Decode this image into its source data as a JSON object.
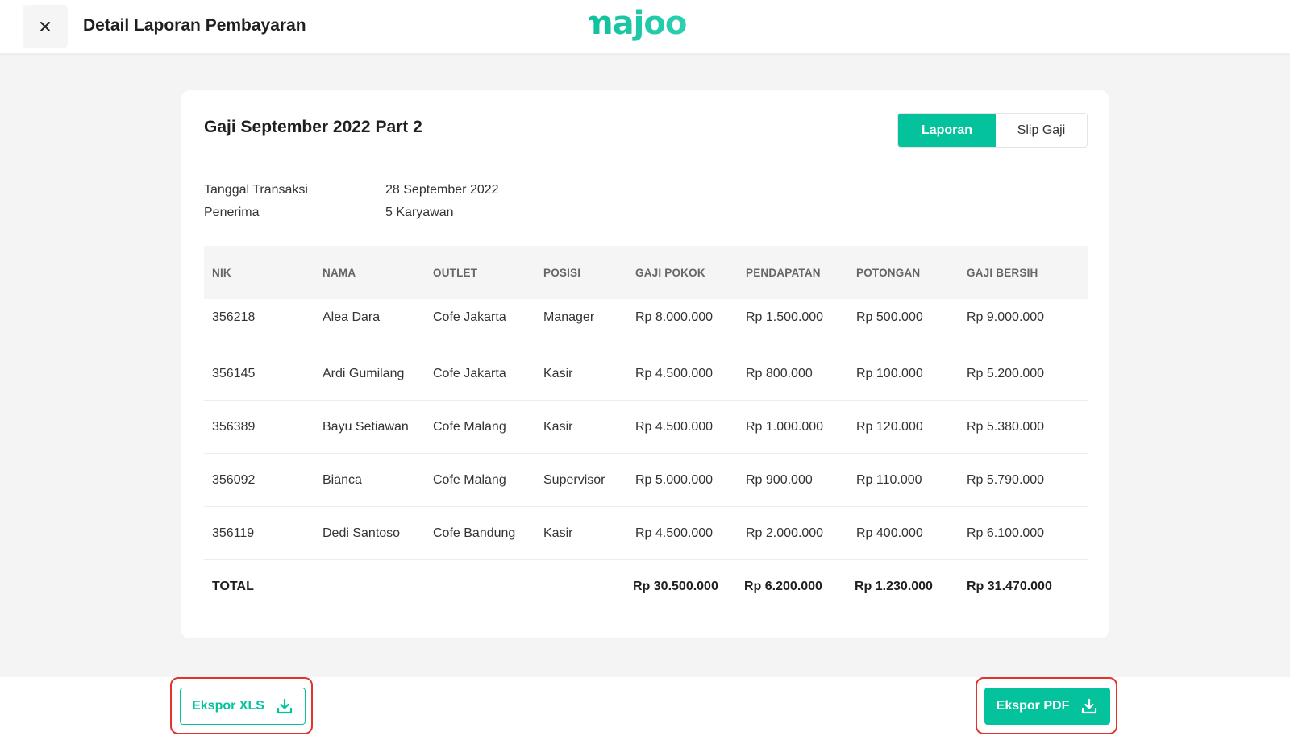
{
  "header": {
    "title": "Detail Laporan Pembayaran",
    "logo_text": "majoo",
    "brand_color": "#04c29c"
  },
  "report": {
    "title": "Gaji September 2022 Part 2",
    "tabs": [
      {
        "label": "Laporan",
        "active": true
      },
      {
        "label": "Slip Gaji",
        "active": false
      }
    ],
    "meta": [
      {
        "label": "Tanggal Transaksi",
        "value": "28 September 2022"
      },
      {
        "label": "Penerima",
        "value": "5 Karyawan"
      }
    ]
  },
  "table": {
    "columns": [
      "NIK",
      "NAMA",
      "OUTLET",
      "POSISI",
      "GAJI POKOK",
      "PENDAPATAN",
      "POTONGAN",
      "GAJI BERSIH"
    ],
    "rows": [
      [
        "356218",
        "Alea Dara",
        "Cofe Jakarta",
        "Manager",
        "Rp 8.000.000",
        "Rp 1.500.000",
        "Rp 500.000",
        "Rp 9.000.000"
      ],
      [
        "356145",
        "Ardi Gumilang",
        "Cofe Jakarta",
        "Kasir",
        "Rp 4.500.000",
        "Rp 800.000",
        "Rp 100.000",
        "Rp 5.200.000"
      ],
      [
        "356389",
        "Bayu Setiawan",
        "Cofe Malang",
        "Kasir",
        "Rp 4.500.000",
        "Rp 1.000.000",
        "Rp 120.000",
        "Rp 5.380.000"
      ],
      [
        "356092",
        "Bianca",
        "Cofe Malang",
        "Supervisor",
        "Rp 5.000.000",
        "Rp 900.000",
        "Rp 110.000",
        "Rp 5.790.000"
      ],
      [
        "356119",
        "Dedi Santoso",
        "Cofe Bandung",
        "Kasir",
        "Rp 4.500.000",
        "Rp 2.000.000",
        "Rp 400.000",
        "Rp 6.100.000"
      ]
    ],
    "total": {
      "label": "TOTAL",
      "values": [
        "Rp 30.500.000",
        "Rp 6.200.000",
        "Rp 1.230.000",
        "Rp 31.470.000"
      ]
    }
  },
  "footer": {
    "export_xls_label": "Ekspor XLS",
    "export_pdf_label": "Ekspor PDF"
  }
}
